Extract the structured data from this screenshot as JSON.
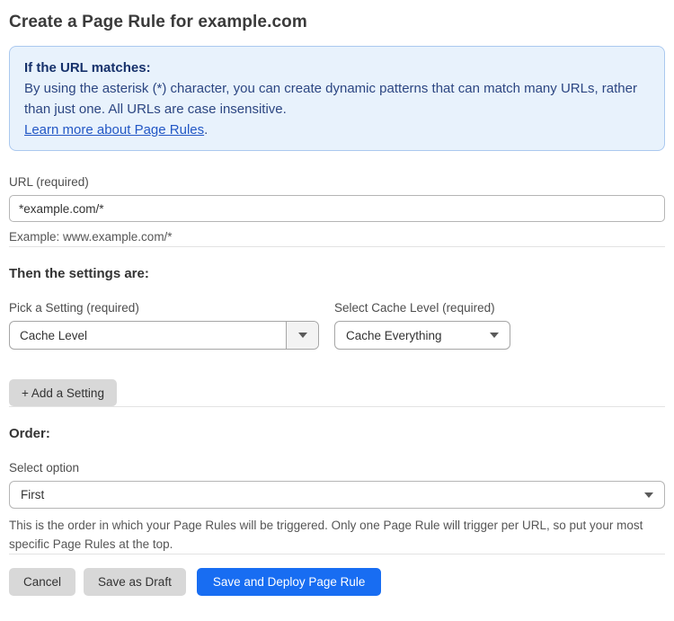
{
  "page": {
    "title": "Create a Page Rule for example.com"
  },
  "info_box": {
    "heading": "If the URL matches:",
    "body": "By using the asterisk (*) character, you can create dynamic patterns that can match many URLs, rather than just one. All URLs are case insensitive.",
    "link_text": "Learn more about Page Rules",
    "link_suffix": "."
  },
  "url_field": {
    "label": "URL (required)",
    "value": "*example.com/*",
    "helper": "Example: www.example.com/*"
  },
  "settings_section": {
    "heading": "Then the settings are:",
    "setting_picker": {
      "label": "Pick a Setting (required)",
      "value": "Cache Level"
    },
    "cache_level_picker": {
      "label": "Select Cache Level (required)",
      "value": "Cache Everything"
    },
    "add_setting_label": "+ Add a Setting"
  },
  "order_section": {
    "heading": "Order:",
    "select_label": "Select option",
    "value": "First",
    "helper": "This is the order in which your Page Rules will be triggered. Only one Page Rule will trigger per URL, so put your most specific Page Rules at the top."
  },
  "actions": {
    "cancel": "Cancel",
    "save_draft": "Save as Draft",
    "save_deploy": "Save and Deploy Page Rule"
  },
  "colors": {
    "info_bg": "#e8f2fc",
    "info_border": "#abc9ef",
    "info_heading": "#16316b",
    "info_text": "#2c4682",
    "link": "#2257c5",
    "primary_button": "#186df2",
    "secondary_button": "#d8d8d8"
  }
}
